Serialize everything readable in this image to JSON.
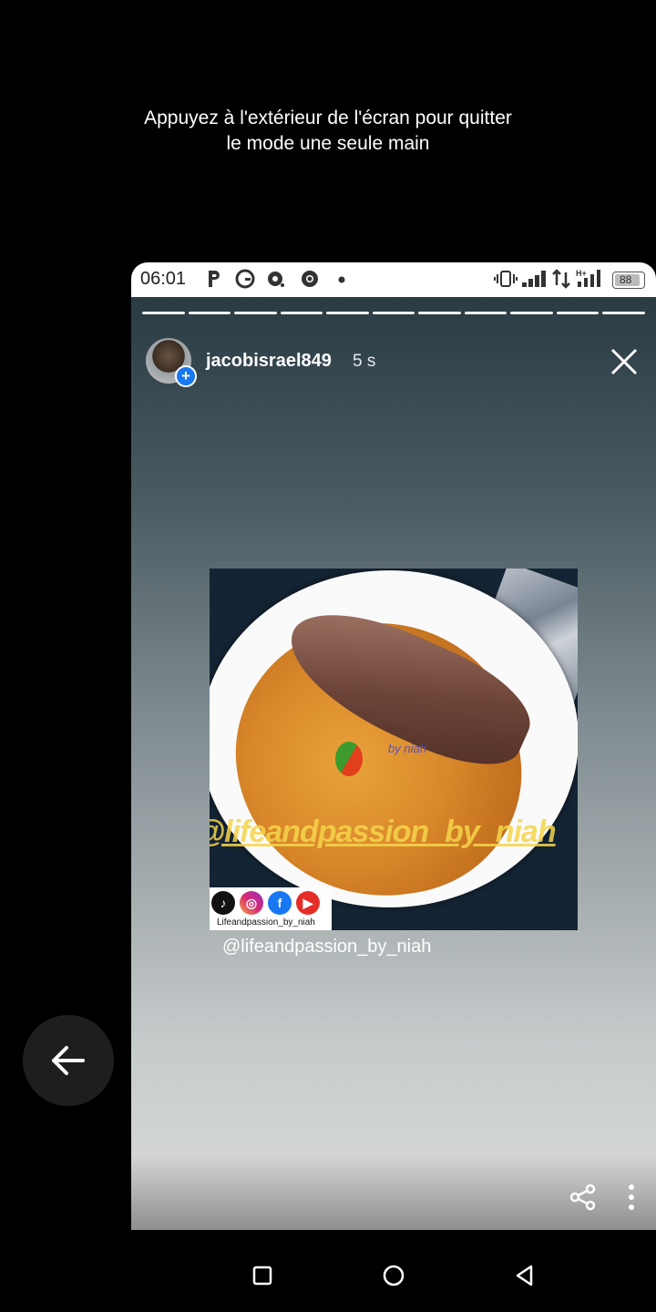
{
  "one_hand_hint": {
    "line1": "Appuyez à l'extérieur de l'écran pour quitter",
    "line2": "le mode une seule main"
  },
  "status_bar": {
    "time": "06:01",
    "battery": "88",
    "icons": [
      "p-icon",
      "g-icon",
      "camera-notification-icon",
      "chrome-icon",
      "dot-icon",
      "vibrate-icon",
      "signal-icon",
      "data-arrows-icon",
      "h-plus-signal-icon",
      "battery-icon"
    ]
  },
  "story": {
    "segments": 11,
    "username": "jacobisrael849",
    "time_ago": "5 s",
    "photo": {
      "watermark": "@lifeandpassion_by_niah",
      "social_handle": "Lifeandpassion_by_niah",
      "signature": "by niah"
    },
    "caption": "@lifeandpassion_by_niah"
  },
  "colors": {
    "accent": "#1877f2",
    "watermark": "#f6d54b"
  }
}
